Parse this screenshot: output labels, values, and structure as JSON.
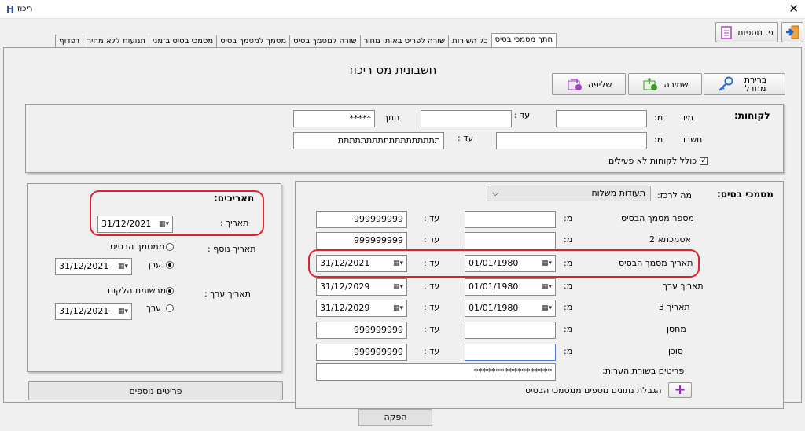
{
  "window": {
    "app_icon": "H",
    "title": "ריכוז",
    "close": "✕"
  },
  "toolbar": {
    "extra_label": "פ. נוספות",
    "exit_icon": "exit-door-icon"
  },
  "tabs": [
    "דפדוף",
    "תנועות ללא מחיר",
    "מסמכי בסיס בזמני",
    "מסמך למסמך בסיס",
    "שורה למסמך בסיס",
    "שורה לפריט באותו מחיר",
    "כל השורות",
    "חתך מסמכי בסיס"
  ],
  "page": {
    "title": "חשבונית מס ריכוז"
  },
  "actions": {
    "default_label": "ברירת מחדל",
    "save_label": "שמירה",
    "load_label": "שליפה"
  },
  "customers": {
    "heading": "לקוחות:",
    "sort_label": "מיון",
    "from_label": "מ:",
    "to_label": "עד :",
    "section_label": "חתך",
    "section_value": "*****",
    "account_label": "חשבון",
    "account_to_label": "עד :",
    "account_to_value": "תתתתתתתתתתתתתתתתתת",
    "include_inactive_label": "כולל לקוחות לא פעילים"
  },
  "dates": {
    "heading": "תאריכים:",
    "date_label": "תאריך :",
    "date_value": "31/12/2021",
    "extra_date_label": "תאריך נוסף :",
    "from_base_doc_label": "ממסמך הבסיס",
    "value_label": "ערך",
    "extra_date_value": "31/12/2021",
    "value_date_label": "תאריך ערך :",
    "customer_record_label": "מרשומת הלקוח",
    "value2_label": "ערך",
    "value_date_value": "31/12/2021",
    "more_items_label": "פריטים נוספים"
  },
  "base_docs": {
    "heading": "מסמכי בסיס:",
    "type_label": "מה לרכז:",
    "type_value": "תעודות משלוח",
    "rows": [
      {
        "label": "מספר מסמך הבסיס",
        "from_label": "מ:",
        "from": "",
        "to_label": "עד :",
        "to": "999999999"
      },
      {
        "label": "אסמכתא 2",
        "from_label": "מ:",
        "from": "",
        "to_label": "עד :",
        "to": "999999999"
      },
      {
        "label": "תאריך מסמך הבסיס",
        "from_label": "מ:",
        "from": "01/01/1980",
        "to_label": "עד :",
        "to": "31/12/2021"
      },
      {
        "label": "תאריך ערך",
        "from_label": "מ:",
        "from": "01/01/1980",
        "to_label": "עד :",
        "to": "31/12/2029"
      },
      {
        "label": "תאריך 3",
        "from_label": "מ:",
        "from": "01/01/1980",
        "to_label": "עד :",
        "to": "31/12/2029"
      },
      {
        "label": "מחסן",
        "from_label": "מ:",
        "from": "",
        "to_label": "עד :",
        "to": "999999999"
      },
      {
        "label": "סוכן",
        "from_label": "מ:",
        "from": "",
        "to_label": "עד :",
        "to": "999999999"
      }
    ],
    "items_in_notes_label": "פריטים בשורת הערות:",
    "items_in_notes_value": "******************",
    "limit_label": "הגבלת נתונים נוספים ממסמכי הבסיס"
  },
  "footer": {
    "produce_label": "הפקה"
  }
}
